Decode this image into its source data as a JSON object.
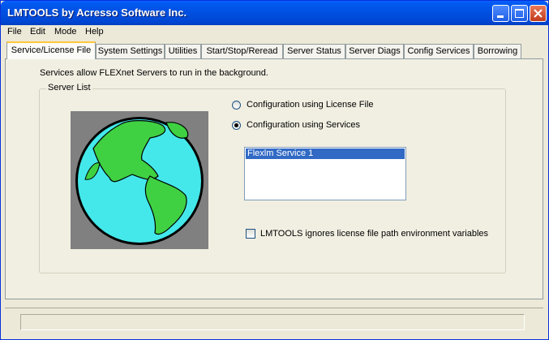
{
  "window": {
    "title": "LMTOOLS by Acresso Software Inc.",
    "controls": {
      "minimize_icon": "minimize-icon",
      "maximize_icon": "maximize-icon",
      "close_icon": "close-icon"
    }
  },
  "menu": {
    "items": [
      "File",
      "Edit",
      "Mode",
      "Help"
    ]
  },
  "tabs": [
    {
      "label": "Service/License File",
      "active": true
    },
    {
      "label": "System Settings"
    },
    {
      "label": "Utilities"
    },
    {
      "label": "Start/Stop/Reread"
    },
    {
      "label": "Server Status"
    },
    {
      "label": "Server Diags"
    },
    {
      "label": "Config Services"
    },
    {
      "label": "Borrowing"
    }
  ],
  "panel": {
    "info_text": "Services allow FLEXnet Servers to run in the background.",
    "server_list": {
      "label": "Server List",
      "radio_options": [
        {
          "label": "Configuration using License File",
          "selected": false
        },
        {
          "label": "Configuration using Services",
          "selected": true
        }
      ],
      "services": [
        "Flexlm Service 1"
      ],
      "ignore_env_checkbox": {
        "label": "LMTOOLS ignores license file path environment variables",
        "checked": false
      }
    }
  },
  "status_bar": {
    "text": ""
  },
  "colors": {
    "titlebar": "#0054e3",
    "selection": "#316ac5",
    "tab_highlight": "#ffc83c",
    "globe_ocean": "#44e8ea",
    "globe_land": "#3fd142"
  }
}
